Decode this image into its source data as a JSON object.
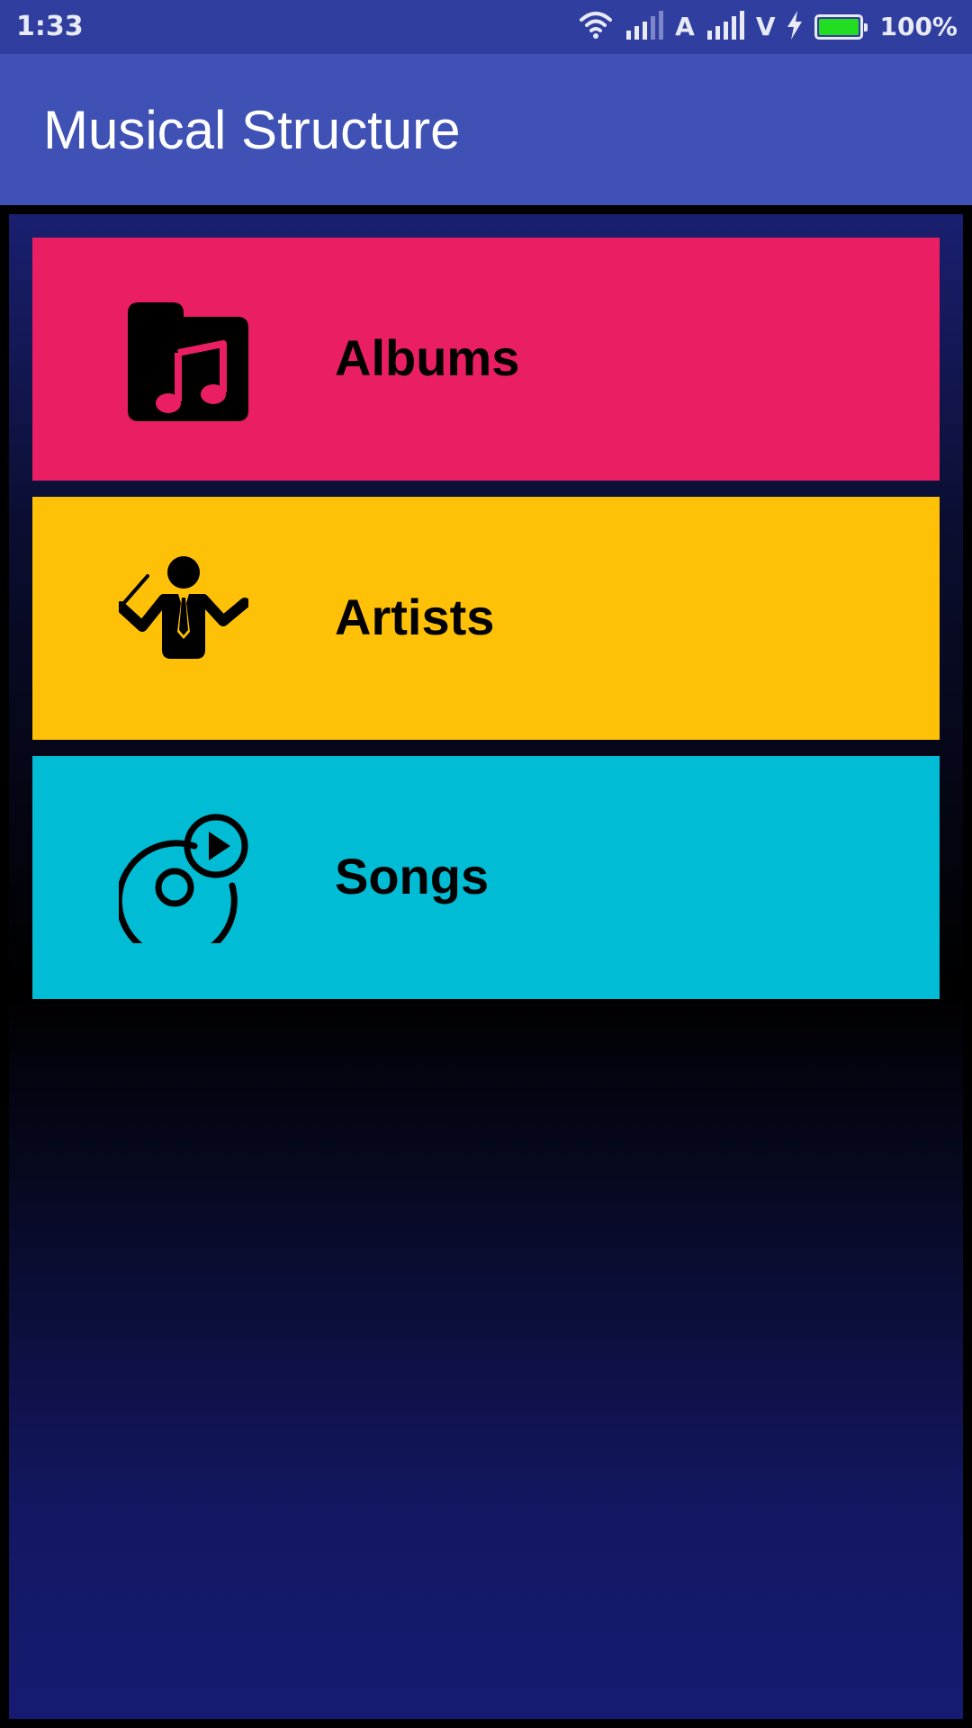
{
  "status_bar": {
    "time": "1:33",
    "sim1_label": "A",
    "sim2_label": "V",
    "battery_percent": "100%",
    "battery_level": 1.0,
    "battery_color": "#22dd22",
    "icons": [
      "wifi-icon",
      "signal-icon",
      "signal-icon",
      "charging-icon",
      "battery-icon"
    ]
  },
  "app_bar": {
    "title": "Musical Structure",
    "color": "#3f51b5"
  },
  "categories": [
    {
      "label": "Albums",
      "color": "#e91e63",
      "icon": "music-folder-icon"
    },
    {
      "label": "Artists",
      "color": "#ffc107",
      "icon": "conductor-icon"
    },
    {
      "label": "Songs",
      "color": "#00bcd4",
      "icon": "disc-play-icon"
    }
  ]
}
